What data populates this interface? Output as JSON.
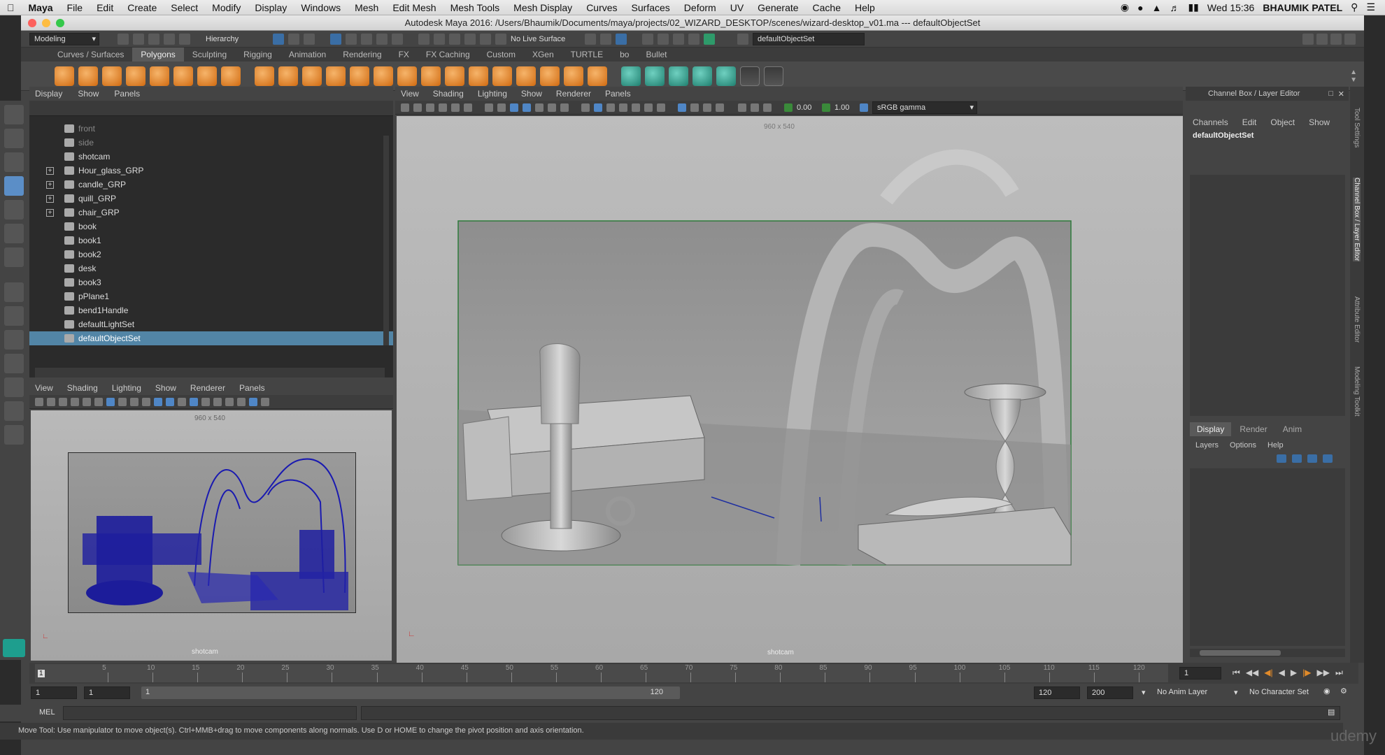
{
  "mac_menubar": {
    "app": "Maya",
    "items": [
      "File",
      "Edit",
      "Create",
      "Select",
      "Modify",
      "Display",
      "Windows",
      "Mesh",
      "Edit Mesh",
      "Mesh Tools",
      "Mesh Display",
      "Curves",
      "Surfaces",
      "Deform",
      "UV",
      "Generate",
      "Cache",
      "Help"
    ],
    "clock": "Wed 15:36",
    "user": "BHAUMIK PATEL"
  },
  "window": {
    "title": "Autodesk Maya 2016: /Users/Bhaumik/Documents/maya/projects/02_WIZARD_DESKTOP/scenes/wizard-desktop_v01.ma   ---   defaultObjectSet"
  },
  "status_line": {
    "menu_set": "Modeling",
    "hierarchy": "Hierarchy",
    "live_surface": "No Live Surface",
    "selection_field": "defaultObjectSet"
  },
  "shelf": {
    "tabs": [
      "Curves / Surfaces",
      "Polygons",
      "Sculpting",
      "Rigging",
      "Animation",
      "Rendering",
      "FX",
      "FX Caching",
      "Custom",
      "XGen",
      "TURTLE",
      "bo",
      "Bullet"
    ],
    "active_tab": "Polygons"
  },
  "outliner": {
    "menu": [
      "Display",
      "Show",
      "Panels"
    ],
    "rows": [
      {
        "label": "front",
        "expandable": false,
        "dim": true
      },
      {
        "label": "side",
        "expandable": false,
        "dim": true
      },
      {
        "label": "shotcam",
        "expandable": false,
        "dim": false
      },
      {
        "label": "Hour_glass_GRP",
        "expandable": true,
        "dim": false
      },
      {
        "label": "candle_GRP",
        "expandable": true,
        "dim": false
      },
      {
        "label": "quill_GRP",
        "expandable": true,
        "dim": false
      },
      {
        "label": "chair_GRP",
        "expandable": true,
        "dim": false
      },
      {
        "label": "book",
        "expandable": false,
        "dim": false
      },
      {
        "label": "book1",
        "expandable": false,
        "dim": false
      },
      {
        "label": "book2",
        "expandable": false,
        "dim": false
      },
      {
        "label": "desk",
        "expandable": false,
        "dim": false
      },
      {
        "label": "book3",
        "expandable": false,
        "dim": false
      },
      {
        "label": "pPlane1",
        "expandable": false,
        "dim": false
      },
      {
        "label": "bend1Handle",
        "expandable": false,
        "dim": false
      },
      {
        "label": "defaultLightSet",
        "expandable": false,
        "dim": false
      },
      {
        "label": "defaultObjectSet",
        "expandable": false,
        "dim": false,
        "selected": true
      }
    ]
  },
  "small_viewport": {
    "menu": [
      "View",
      "Shading",
      "Lighting",
      "Show",
      "Renderer",
      "Panels"
    ],
    "resolution": "960 x 540",
    "camera": "shotcam"
  },
  "main_viewport": {
    "menu": [
      "View",
      "Shading",
      "Lighting",
      "Show",
      "Renderer",
      "Panels"
    ],
    "resolution": "960 x 540",
    "camera": "shotcam",
    "exposure": "0.00",
    "gamma": "1.00",
    "color_space": "sRGB gamma"
  },
  "channel_box": {
    "title": "Channel Box / Layer Editor",
    "menu": [
      "Channels",
      "Edit",
      "Object",
      "Show"
    ],
    "selected_object": "defaultObjectSet",
    "layer_tabs": [
      "Display",
      "Render",
      "Anim"
    ],
    "active_layer_tab": "Display",
    "layer_menu": [
      "Layers",
      "Options",
      "Help"
    ]
  },
  "side_tabs": [
    "Tool Settings",
    "Channel Box / Layer Editor",
    "Attribute Editor",
    "Modeling Toolkit"
  ],
  "timeline": {
    "ticks": [
      "5",
      "10",
      "15",
      "20",
      "25",
      "30",
      "35",
      "40",
      "45",
      "50",
      "55",
      "60",
      "65",
      "70",
      "75",
      "80",
      "85",
      "90",
      "95",
      "100",
      "105",
      "110",
      "115",
      "120"
    ],
    "first": "1",
    "current_frame": "1"
  },
  "range": {
    "start": "1",
    "anim_start": "1",
    "slider_start": "1",
    "slider_end": "120",
    "anim_end": "120",
    "end": "200",
    "anim_layer": "No Anim Layer",
    "character_set": "No Character Set"
  },
  "command_line": {
    "label": "MEL"
  },
  "help_line": {
    "text": "Move Tool: Use manipulator to move object(s). Ctrl+MMB+drag to move components along normals. Use D or HOME to change the pivot position and axis orientation."
  },
  "watermark": "udemy"
}
